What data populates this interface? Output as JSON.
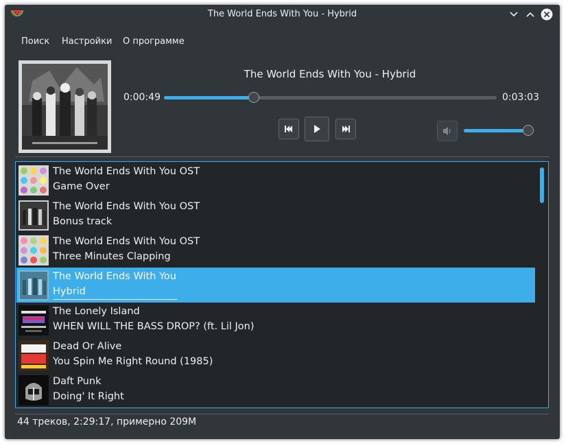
{
  "window": {
    "title": "The World Ends With You - Hybrid"
  },
  "menu": {
    "items": [
      {
        "label": "Поиск"
      },
      {
        "label": "Настройки"
      },
      {
        "label": "О программе"
      }
    ]
  },
  "player": {
    "now_playing": "The World Ends With You  - Hybrid",
    "elapsed": "0:00:49",
    "duration": "0:03:03",
    "progress_fraction": 0.27,
    "volume_fraction": 0.97
  },
  "playlist": {
    "items": [
      {
        "artist": "The World Ends With You OST",
        "title": "Game Over",
        "thumb": "pins-grid",
        "selected": false
      },
      {
        "artist": "The World Ends With You OST",
        "title": "Bonus track",
        "thumb": "twewy-cover",
        "selected": false
      },
      {
        "artist": "The World Ends With You OST",
        "title": "Three Minutes Clapping",
        "thumb": "pins-grid",
        "selected": false
      },
      {
        "artist": "The World Ends With You",
        "title": "Hybrid",
        "thumb": "twewy-cover",
        "selected": true
      },
      {
        "artist": "The Lonely Island",
        "title": " WHEN WILL THE BASS DROP? (ft. Lil Jon)",
        "thumb": "lonely-island",
        "selected": false
      },
      {
        "artist": "Dead Or Alive",
        "title": "You Spin Me Right Round (1985)",
        "thumb": "party-hits",
        "selected": false
      },
      {
        "artist": "Daft Punk",
        "title": "Doing' It Right",
        "thumb": "daft-punk",
        "selected": false
      }
    ]
  },
  "status": {
    "summary": "44 треков, 2:29:17, примерно 209M"
  },
  "colors": {
    "window_bg": "#31363b",
    "list_bg": "#232629",
    "accent": "#3daee9",
    "text": "#eff0f1"
  }
}
